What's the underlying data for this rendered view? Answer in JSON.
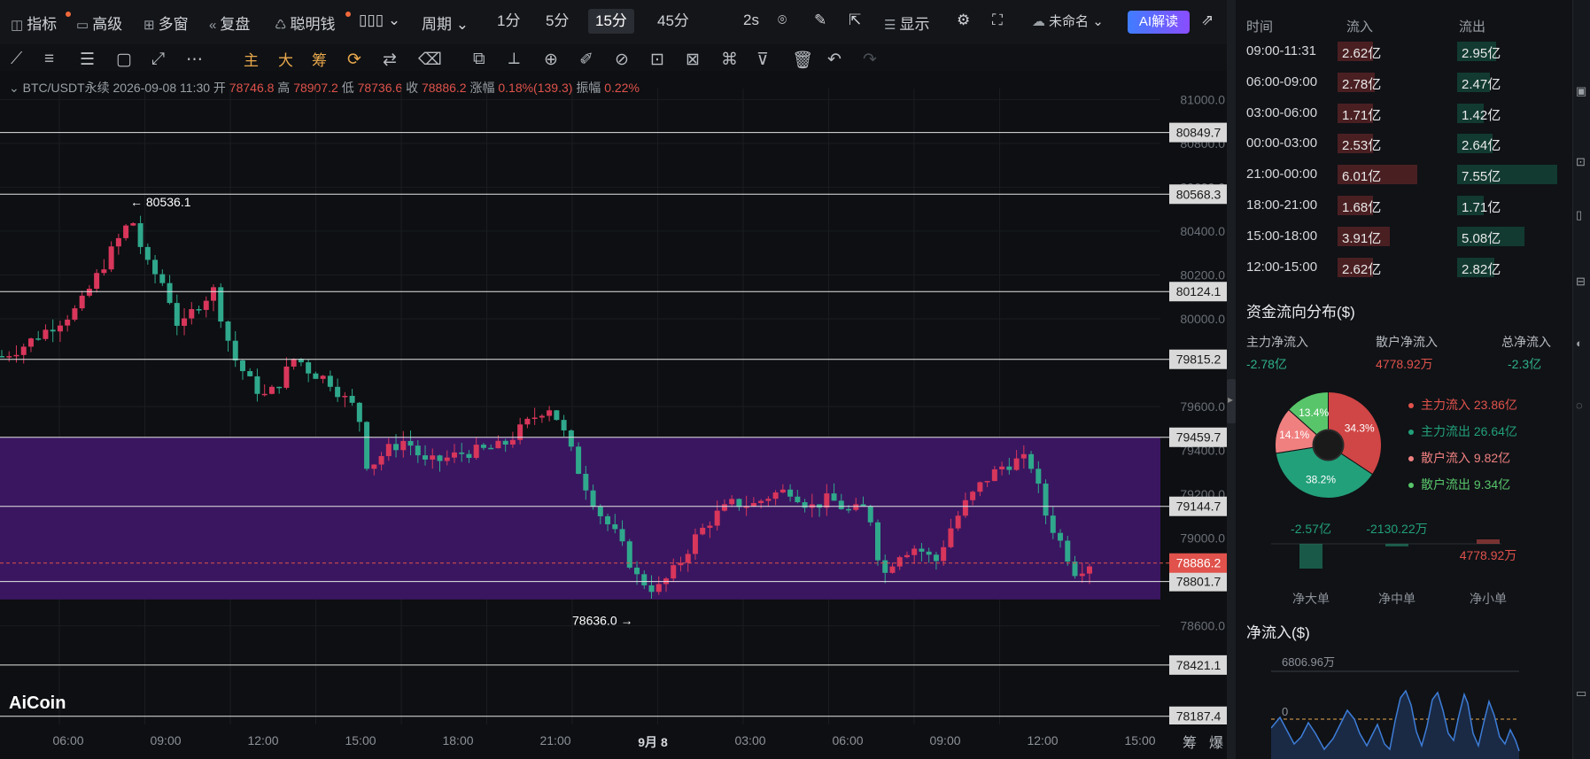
{
  "toolbar": {
    "indicators": "指标",
    "advanced": "高级",
    "multi_window": "多窗",
    "replay": "复盘",
    "smart_money": "聪明钱",
    "period": "周期",
    "periods": [
      "1分",
      "5分",
      "15分",
      "45分"
    ],
    "active_period": "15分",
    "refresh": "2s",
    "display": "显示",
    "unnamed": "未命名",
    "ai_read": "AI解读"
  },
  "drawing_toolbar": {
    "main": "主",
    "large": "大",
    "chips": "筹"
  },
  "info_bar": {
    "symbol": "BTC/USDT永续",
    "datetime": "2026-09-08 11:30",
    "open_label": "开",
    "open": "78746.8",
    "high_label": "高",
    "high": "78907.2",
    "low_label": "低",
    "low": "78736.6",
    "close_label": "收",
    "close": "78886.2",
    "change_label": "涨幅",
    "change": "0.18%(139.3)",
    "amp_label": "振幅",
    "amp": "0.22%"
  },
  "chart_data": {
    "type": "candlestick",
    "y_axis_ticks": [
      "81000.0",
      "80800.0",
      "80600.0",
      "80400.0",
      "80200.0",
      "80000.0",
      "79600.0",
      "79400.0",
      "79200.0",
      "79000.0",
      "78600.0"
    ],
    "x_axis_ticks": [
      "06:00",
      "09:00",
      "12:00",
      "15:00",
      "18:00",
      "21:00",
      "9月 8",
      "03:00",
      "06:00",
      "09:00",
      "12:00",
      "15:00"
    ],
    "horizontal_levels": [
      "80849.7",
      "80568.3",
      "80124.1",
      "79815.2",
      "79459.7",
      "79144.7",
      "78801.7",
      "78421.1",
      "78187.4"
    ],
    "current_price": "78886.2",
    "high_marker": "80536.1",
    "low_marker": "78636.0",
    "zone": {
      "top": 79459.7,
      "bottom": 78720.0
    },
    "ylim": [
      78150,
      81050
    ],
    "colors": {
      "up": "#d8365b",
      "down": "#2fa88c",
      "zone": "#3a1660",
      "price_line": "#e0524b"
    },
    "watermark": "AiCoin"
  },
  "axis_corner": {
    "left": "筹",
    "right": "爆"
  },
  "right_panel": {
    "flow_table": {
      "headers": [
        "时间",
        "流入",
        "流出"
      ],
      "rows": [
        {
          "time": "09:00-11:31",
          "in": "2.62亿",
          "out": "2.95亿",
          "in_v": 2.62,
          "out_v": 2.95
        },
        {
          "time": "06:00-09:00",
          "in": "2.78亿",
          "out": "2.47亿",
          "in_v": 2.78,
          "out_v": 2.47
        },
        {
          "time": "03:00-06:00",
          "in": "1.71亿",
          "out": "1.42亿",
          "in_v": 1.71,
          "out_v": 1.42
        },
        {
          "time": "00:00-03:00",
          "in": "2.53亿",
          "out": "2.64亿",
          "in_v": 2.53,
          "out_v": 2.64
        },
        {
          "time": "21:00-00:00",
          "in": "6.01亿",
          "out": "7.55亿",
          "in_v": 6.01,
          "out_v": 7.55
        },
        {
          "time": "18:00-21:00",
          "in": "1.68亿",
          "out": "1.71亿",
          "in_v": 1.68,
          "out_v": 1.71
        },
        {
          "time": "15:00-18:00",
          "in": "3.91亿",
          "out": "5.08亿",
          "in_v": 3.91,
          "out_v": 5.08
        },
        {
          "time": "12:00-15:00",
          "in": "2.62亿",
          "out": "2.82亿",
          "in_v": 2.62,
          "out_v": 2.82
        }
      ]
    },
    "distribution": {
      "title": "资金流向分布($)",
      "main_net_label": "主力净流入",
      "main_net": "-2.78亿",
      "retail_net_label": "散户净流入",
      "retail_net": "4778.92万",
      "total_net_label": "总净流入",
      "total_net": "-2.3亿",
      "pie": [
        {
          "pct": "34.3%",
          "value": 34.3,
          "color": "#d04545"
        },
        {
          "pct": "38.2%",
          "value": 38.2,
          "color": "#22a07a"
        },
        {
          "pct": "14.1%",
          "value": 14.1,
          "color": "#f08080"
        },
        {
          "pct": "13.4%",
          "value": 13.4,
          "color": "#58c56a"
        }
      ],
      "legend": [
        {
          "label": "主力流入 23.86亿",
          "color": "#e0524b"
        },
        {
          "label": "主力流出 26.64亿",
          "color": "#22a07a"
        },
        {
          "label": "散户流入 9.82亿",
          "color": "#f08080"
        },
        {
          "label": "散户流出 9.34亿",
          "color": "#58c56a"
        }
      ],
      "bars": [
        {
          "label": "净大单",
          "value": "-2.57亿",
          "color": "#22a07a"
        },
        {
          "label": "净中单",
          "value": "-2130.22万",
          "color": "#22a07a"
        },
        {
          "label": "净小单",
          "value": "4778.92万",
          "color": "#e0524b"
        }
      ]
    },
    "net_inflow": {
      "title": "净流入($)",
      "max_label": "6806.96万",
      "zero_label": "0"
    }
  }
}
